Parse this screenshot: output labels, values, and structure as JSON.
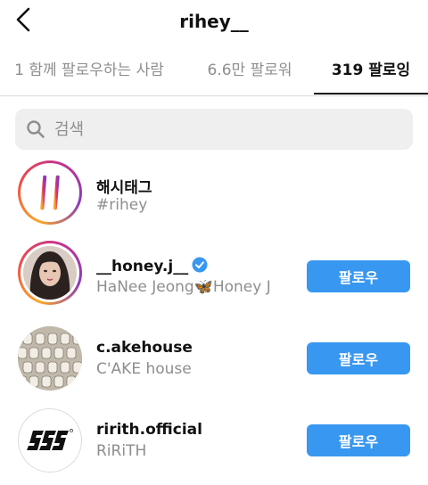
{
  "header": {
    "back_icon": "chevron-left-icon",
    "title": "rihey__"
  },
  "tabs": [
    {
      "label": "1 함께 팔로우하는 사람",
      "active": false
    },
    {
      "label": "6.6만 팔로워",
      "active": false
    },
    {
      "label": "319 팔로잉",
      "active": true
    }
  ],
  "search": {
    "placeholder": "검색",
    "icon": "search-icon"
  },
  "list": [
    {
      "name": "해시태그",
      "subtitle": "#rihey",
      "icon": "hashtag-icon"
    },
    {
      "name": "__honey.j__",
      "subtitle": "HaNee Jeong🦋Honey J",
      "verified": true,
      "button": "팔로우"
    },
    {
      "name": "c.akehouse",
      "subtitle": "C'AKE house",
      "button": "팔로우"
    },
    {
      "name": "ririth.official",
      "subtitle": "RiRiTH",
      "button": "팔로우"
    }
  ],
  "colors": {
    "accent": "#3897f0",
    "text": "#111111",
    "muted": "#8e8e8e",
    "search_bg": "#efefef"
  }
}
